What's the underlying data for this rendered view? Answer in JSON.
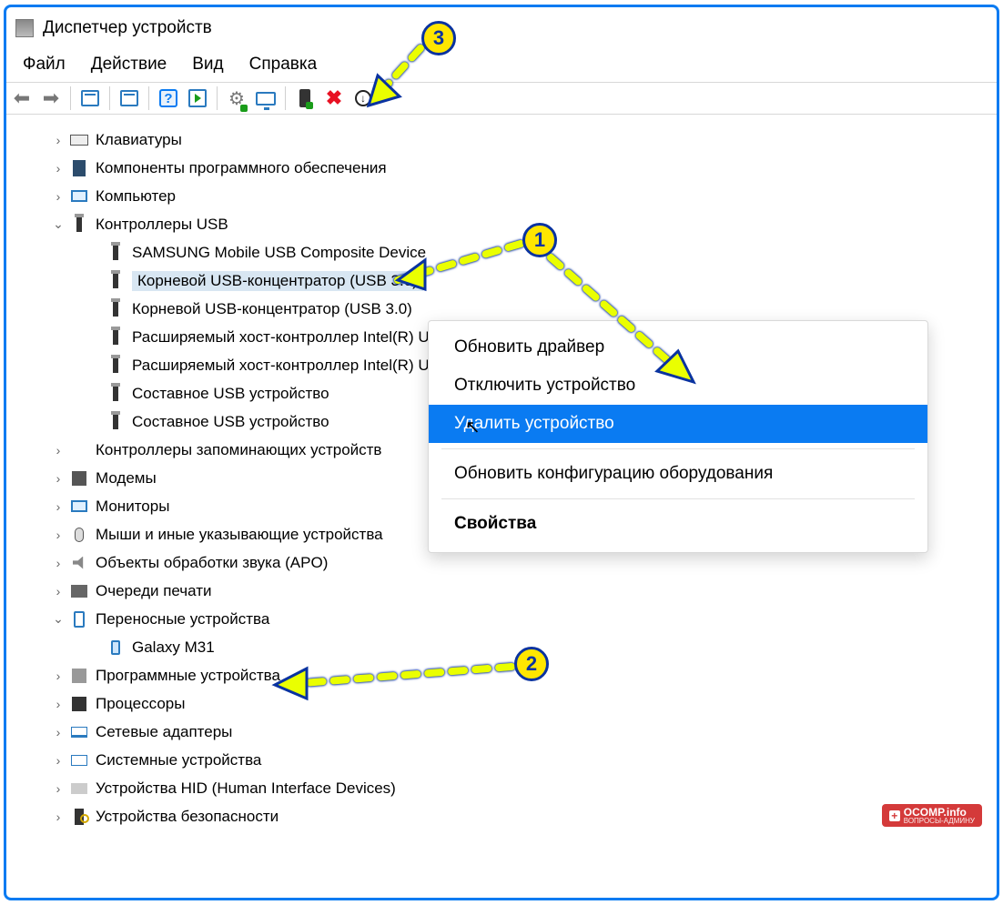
{
  "title": "Диспетчер устройств",
  "menu": {
    "file": "Файл",
    "action": "Действие",
    "view": "Вид",
    "help": "Справка"
  },
  "tree": [
    {
      "label": "Клавиатуры",
      "icon": "ic-kb",
      "depth": 1,
      "expand": ">"
    },
    {
      "label": "Компоненты программного обеспечения",
      "icon": "ic-comp",
      "depth": 1,
      "expand": ">"
    },
    {
      "label": "Компьютер",
      "icon": "ic-mon",
      "depth": 1,
      "expand": ">"
    },
    {
      "label": "Контроллеры USB",
      "icon": "ic-usb",
      "depth": 1,
      "expand": "v"
    },
    {
      "label": "SAMSUNG Mobile USB Composite Device",
      "icon": "ic-usb",
      "depth": 2,
      "expand": ""
    },
    {
      "label": "Корневой USB-концентратор (USB 3.0)",
      "icon": "ic-usb",
      "depth": 2,
      "expand": "",
      "selected": true
    },
    {
      "label": "Корневой USB-концентратор (USB 3.0)",
      "icon": "ic-usb",
      "depth": 2,
      "expand": ""
    },
    {
      "label": "Расширяемый хост-контроллер Intel(R) USB 3.1",
      "icon": "ic-usb",
      "depth": 2,
      "expand": ""
    },
    {
      "label": "Расширяемый хост-контроллер Intel(R) USB 3.1",
      "icon": "ic-usb",
      "depth": 2,
      "expand": ""
    },
    {
      "label": "Составное USB устройство",
      "icon": "ic-usb",
      "depth": 2,
      "expand": ""
    },
    {
      "label": "Составное USB устройство",
      "icon": "ic-usb",
      "depth": 2,
      "expand": ""
    },
    {
      "label": "Контроллеры запоминающих устройств",
      "icon": "ic-store",
      "depth": 1,
      "expand": ">"
    },
    {
      "label": "Модемы",
      "icon": "ic-modem",
      "depth": 1,
      "expand": ">"
    },
    {
      "label": "Мониторы",
      "icon": "ic-mon",
      "depth": 1,
      "expand": ">"
    },
    {
      "label": "Мыши и иные указывающие устройства",
      "icon": "ic-mouse",
      "depth": 1,
      "expand": ">"
    },
    {
      "label": "Объекты обработки звука (APO)",
      "icon": "ic-sound",
      "depth": 1,
      "expand": ">"
    },
    {
      "label": "Очереди печати",
      "icon": "ic-print",
      "depth": 1,
      "expand": ">"
    },
    {
      "label": "Переносные устройства",
      "icon": "ic-tablet",
      "depth": 1,
      "expand": "v"
    },
    {
      "label": "Galaxy M31",
      "icon": "ic-phone",
      "depth": 2,
      "expand": ""
    },
    {
      "label": "Программные устройства",
      "icon": "ic-sw",
      "depth": 1,
      "expand": ">"
    },
    {
      "label": "Процессоры",
      "icon": "ic-cpu",
      "depth": 1,
      "expand": ">"
    },
    {
      "label": "Сетевые адаптеры",
      "icon": "ic-net",
      "depth": 1,
      "expand": ">"
    },
    {
      "label": "Системные устройства",
      "icon": "ic-sys",
      "depth": 1,
      "expand": ">"
    },
    {
      "label": "Устройства HID (Human Interface Devices)",
      "icon": "ic-hid",
      "depth": 1,
      "expand": ">"
    },
    {
      "label": "Устройства безопасности",
      "icon": "ic-sec",
      "depth": 1,
      "expand": ">"
    }
  ],
  "ctx": {
    "update": "Обновить драйвер",
    "disable": "Отключить устройство",
    "remove": "Удалить устройство",
    "rescan": "Обновить конфигурацию оборудования",
    "props": "Свойства"
  },
  "badges": {
    "b1": "1",
    "b2": "2",
    "b3": "3"
  },
  "watermark": {
    "text": "OCOMP.info",
    "sub": "ВОПРОСЫ-АДМИНУ"
  }
}
